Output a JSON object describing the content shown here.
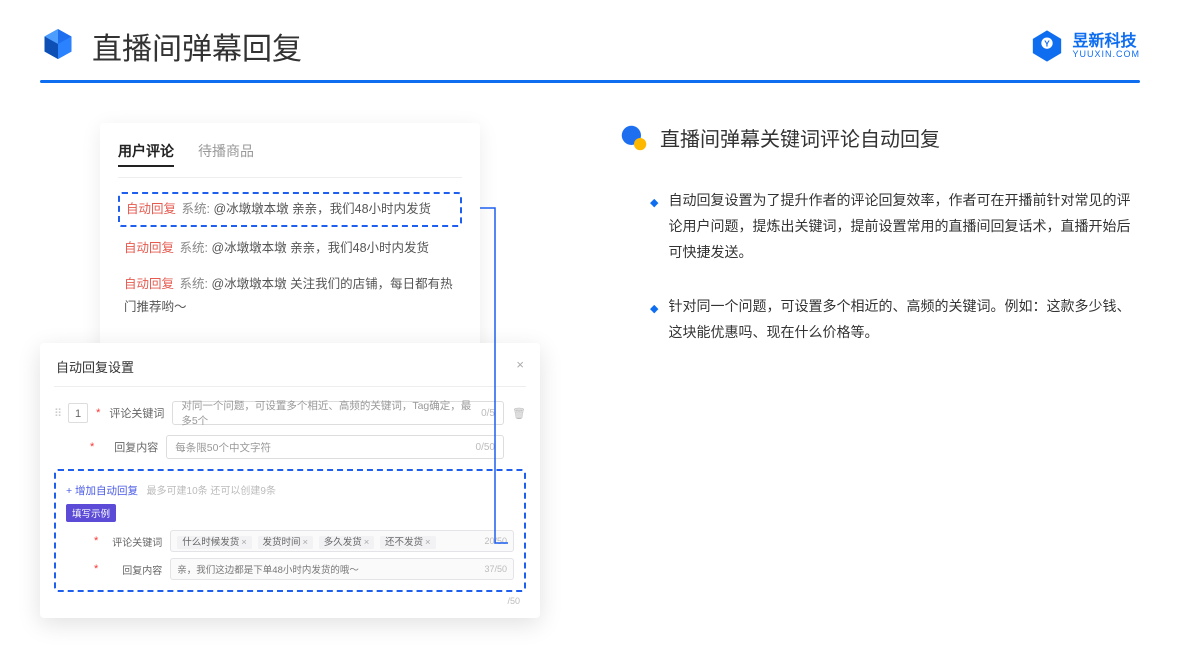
{
  "header": {
    "title": "直播间弹幕回复",
    "brand_cn": "昱新科技",
    "brand_en": "YUUXIN.COM"
  },
  "card_a": {
    "tab_active": "用户评论",
    "tab_inactive": "待播商品",
    "comment1": {
      "tag": "自动回复",
      "sys": "系统:",
      "text": "@冰墩墩本墩 亲亲，我们48小时内发货"
    },
    "comment2": {
      "tag": "自动回复",
      "sys": "系统:",
      "text": "@冰墩墩本墩 亲亲，我们48小时内发货"
    },
    "comment3": {
      "tag": "自动回复",
      "sys": "系统:",
      "text": "@冰墩墩本墩 关注我们的店铺，每日都有热门推荐哟～"
    }
  },
  "card_b": {
    "title": "自动回复设置",
    "num": "1",
    "row1_label": "评论关键词",
    "row1_placeholder": "对同一个问题，可设置多个相近、高频的关键词，Tag确定，最多5个",
    "row1_count": "0/5",
    "row2_label": "回复内容",
    "row2_placeholder": "每条限50个中文字符",
    "row2_count": "0/50",
    "add_link": "+ 增加自动回复",
    "add_hint": "最多可建10条 还可以创建9条",
    "pill": "填写示例",
    "ex_row1_label": "评论关键词",
    "ex_tags": [
      "什么时候发货",
      "发货时间",
      "多久发货",
      "还不发货"
    ],
    "ex_row1_count": "20/50",
    "ex_row2_label": "回复内容",
    "ex_row2_text": "亲，我们这边都是下单48小时内发货的哦～",
    "ex_row2_count": "37/50",
    "outer_count": "/50"
  },
  "right": {
    "title": "直播间弹幕关键词评论自动回复",
    "bullet1": "自动回复设置为了提升作者的评论回复效率，作者可在开播前针对常见的评论用户问题，提炼出关键词，提前设置常用的直播间回复话术，直播开始后可快捷发送。",
    "bullet2": "针对同一个问题，可设置多个相近的、高频的关键词。例如：这款多少钱、这块能优惠吗、现在什么价格等。"
  }
}
